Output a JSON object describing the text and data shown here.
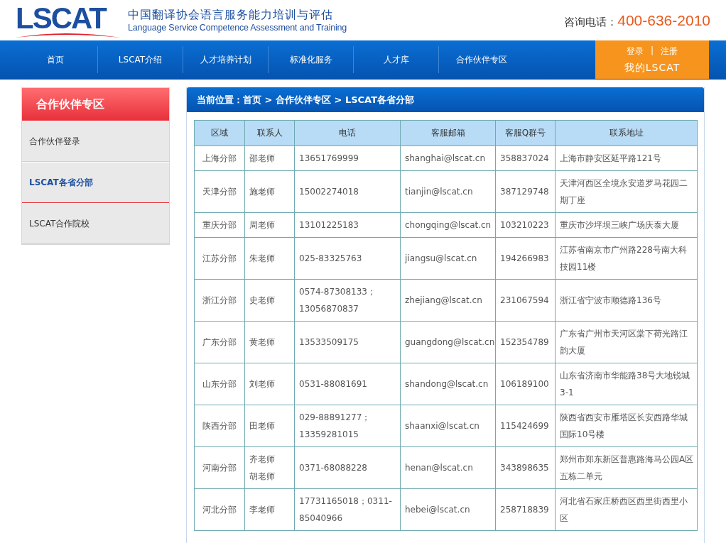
{
  "header": {
    "logo": "LSCAT",
    "title_cn": "中国翻译协会语言服务能力培训与评估",
    "title_en": "Language Service Competence Assessment and Training",
    "hotline_label": "咨询电话：",
    "hotline": "400-636-2010"
  },
  "nav": [
    {
      "label": "首页",
      "selected": false
    },
    {
      "label": "LSCAT介绍",
      "selected": false
    },
    {
      "label": "人才培养计划",
      "selected": false
    },
    {
      "label": "标准化服务",
      "selected": false
    },
    {
      "label": "人才库",
      "selected": false
    },
    {
      "label": "合作伙伴专区",
      "selected": false
    }
  ],
  "account": {
    "login": "登录",
    "separator": "|",
    "register": "注册",
    "my": "我的LSCAT"
  },
  "sidebar": {
    "title": "合作伙伴专区",
    "items": [
      {
        "label": "合作伙伴登录",
        "selected": false
      },
      {
        "label": "LSCAT各省分部",
        "selected": true
      },
      {
        "label": "LSCAT合作院校",
        "selected": false
      }
    ]
  },
  "breadcrumb": "当前位置：首页 > 合作伙伴专区 > LSCAT各省分部",
  "table": {
    "columns": [
      "区域",
      "联系人",
      "电话",
      "客服邮箱",
      "客服Q群号",
      "联系地址"
    ],
    "rows": [
      {
        "region": "上海分部",
        "contacts": [
          "邵老师"
        ],
        "phone": [
          "13651769999"
        ],
        "email": "shanghai@lscat.cn",
        "qq": "358837024",
        "address": [
          "上海市静安区延平路121号"
        ]
      },
      {
        "region": "天津分部",
        "contacts": [
          "施老师"
        ],
        "phone": [
          "15002274018"
        ],
        "email": "tianjin@lscat.cn",
        "qq": "387129748",
        "address": [
          "天津河西区全境永安道罗马花园二",
          "期丁座"
        ]
      },
      {
        "region": "重庆分部",
        "contacts": [
          "周老师"
        ],
        "phone": [
          "13101225183"
        ],
        "email": "chongqing@lscat.cn",
        "qq": "103210223",
        "address": [
          "重庆市沙坪坝三峡广场庆泰大厦"
        ]
      },
      {
        "region": "江苏分部",
        "contacts": [
          "朱老师"
        ],
        "phone": [
          "025-83325763"
        ],
        "email": "jiangsu@lscat.cn",
        "qq": "194266983",
        "address": [
          "江苏省南京市广州路228号南大科",
          "技园11楼"
        ]
      },
      {
        "region": "浙江分部",
        "contacts": [
          "史老师"
        ],
        "phone": [
          "0574-87308133；",
          "13056870837"
        ],
        "email": "zhejiang@lscat.cn",
        "qq": "231067594",
        "address": [
          "浙江省宁波市顺德路136号"
        ]
      },
      {
        "region": "广东分部",
        "contacts": [
          "黄老师"
        ],
        "phone": [
          "13533509175"
        ],
        "email": "guangdong@lscat.cn",
        "qq": "152354789",
        "address": [
          "广东省广州市天河区棠下荷光路江",
          "韵大厦"
        ]
      },
      {
        "region": "山东分部",
        "contacts": [
          "刘老师"
        ],
        "phone": [
          "0531-88081691"
        ],
        "email": "shandong@lscat.cn",
        "qq": "106189100",
        "address": [
          "山东省济南市华能路38号大地锐城",
          "3-1"
        ]
      },
      {
        "region": "陕西分部",
        "contacts": [
          "田老师"
        ],
        "phone": [
          "029-88891277；",
          "13359281015"
        ],
        "email": "shaanxi@lscat.cn",
        "qq": "115424699",
        "address": [
          "陕西省西安市雁塔区长安西路华城",
          "国际10号楼"
        ]
      },
      {
        "region": "河南分部",
        "contacts": [
          "齐老师",
          "胡老师"
        ],
        "phone": [
          "0371-68088228"
        ],
        "email": "henan@lscat.cn",
        "qq": "343898635",
        "address": [
          "郑州市郑东新区普惠路海马公园A区",
          "五栋二单元"
        ]
      },
      {
        "region": "河北分部",
        "contacts": [
          "李老师"
        ],
        "phone": [
          "17731165018；0311-",
          "85040966"
        ],
        "email": "hebei@lscat.cn",
        "qq": "258718839",
        "address": [
          "河北省石家庄桥西区西里街西里小",
          "区"
        ]
      }
    ]
  }
}
